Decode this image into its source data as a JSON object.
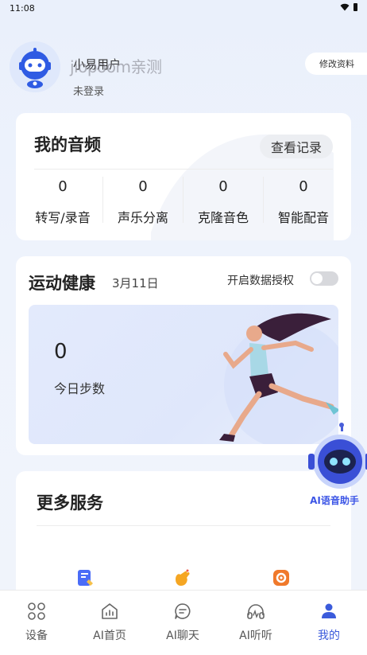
{
  "status_bar": {
    "time": "11:08"
  },
  "profile": {
    "username": "小易用户",
    "watermark": "jiopoom亲测",
    "login_status": "未登录",
    "edit_button": "修改资料"
  },
  "audio": {
    "title": "我的音频",
    "history_button": "查看记录",
    "stats": [
      {
        "value": "0",
        "label": "转写/录音"
      },
      {
        "value": "0",
        "label": "声乐分离"
      },
      {
        "value": "0",
        "label": "克隆音色"
      },
      {
        "value": "0",
        "label": "智能配音"
      }
    ]
  },
  "health": {
    "title": "运动健康",
    "date": "3月11日",
    "auth_label": "开启数据授权",
    "auth_enabled": false,
    "steps_value": "0",
    "steps_label": "今日步数"
  },
  "services": {
    "title": "更多服务",
    "items": [
      {
        "icon": "book-icon",
        "color": "#4a6cf7"
      },
      {
        "icon": "clap-icon",
        "color": "#f5a623"
      },
      {
        "icon": "settings-gear-icon",
        "color": "#f0792b"
      }
    ]
  },
  "ai_assistant": {
    "label": "AI语音助手"
  },
  "bottom_nav": {
    "items": [
      {
        "label": "设备",
        "icon": "devices-grid-icon"
      },
      {
        "label": "AI首页",
        "icon": "home-chart-icon"
      },
      {
        "label": "AI聊天",
        "icon": "chat-bubble-icon"
      },
      {
        "label": "AI听听",
        "icon": "headphones-icon"
      },
      {
        "label": "我的",
        "icon": "profile-icon",
        "active": true
      }
    ],
    "active_color": "#3b5bdb"
  }
}
